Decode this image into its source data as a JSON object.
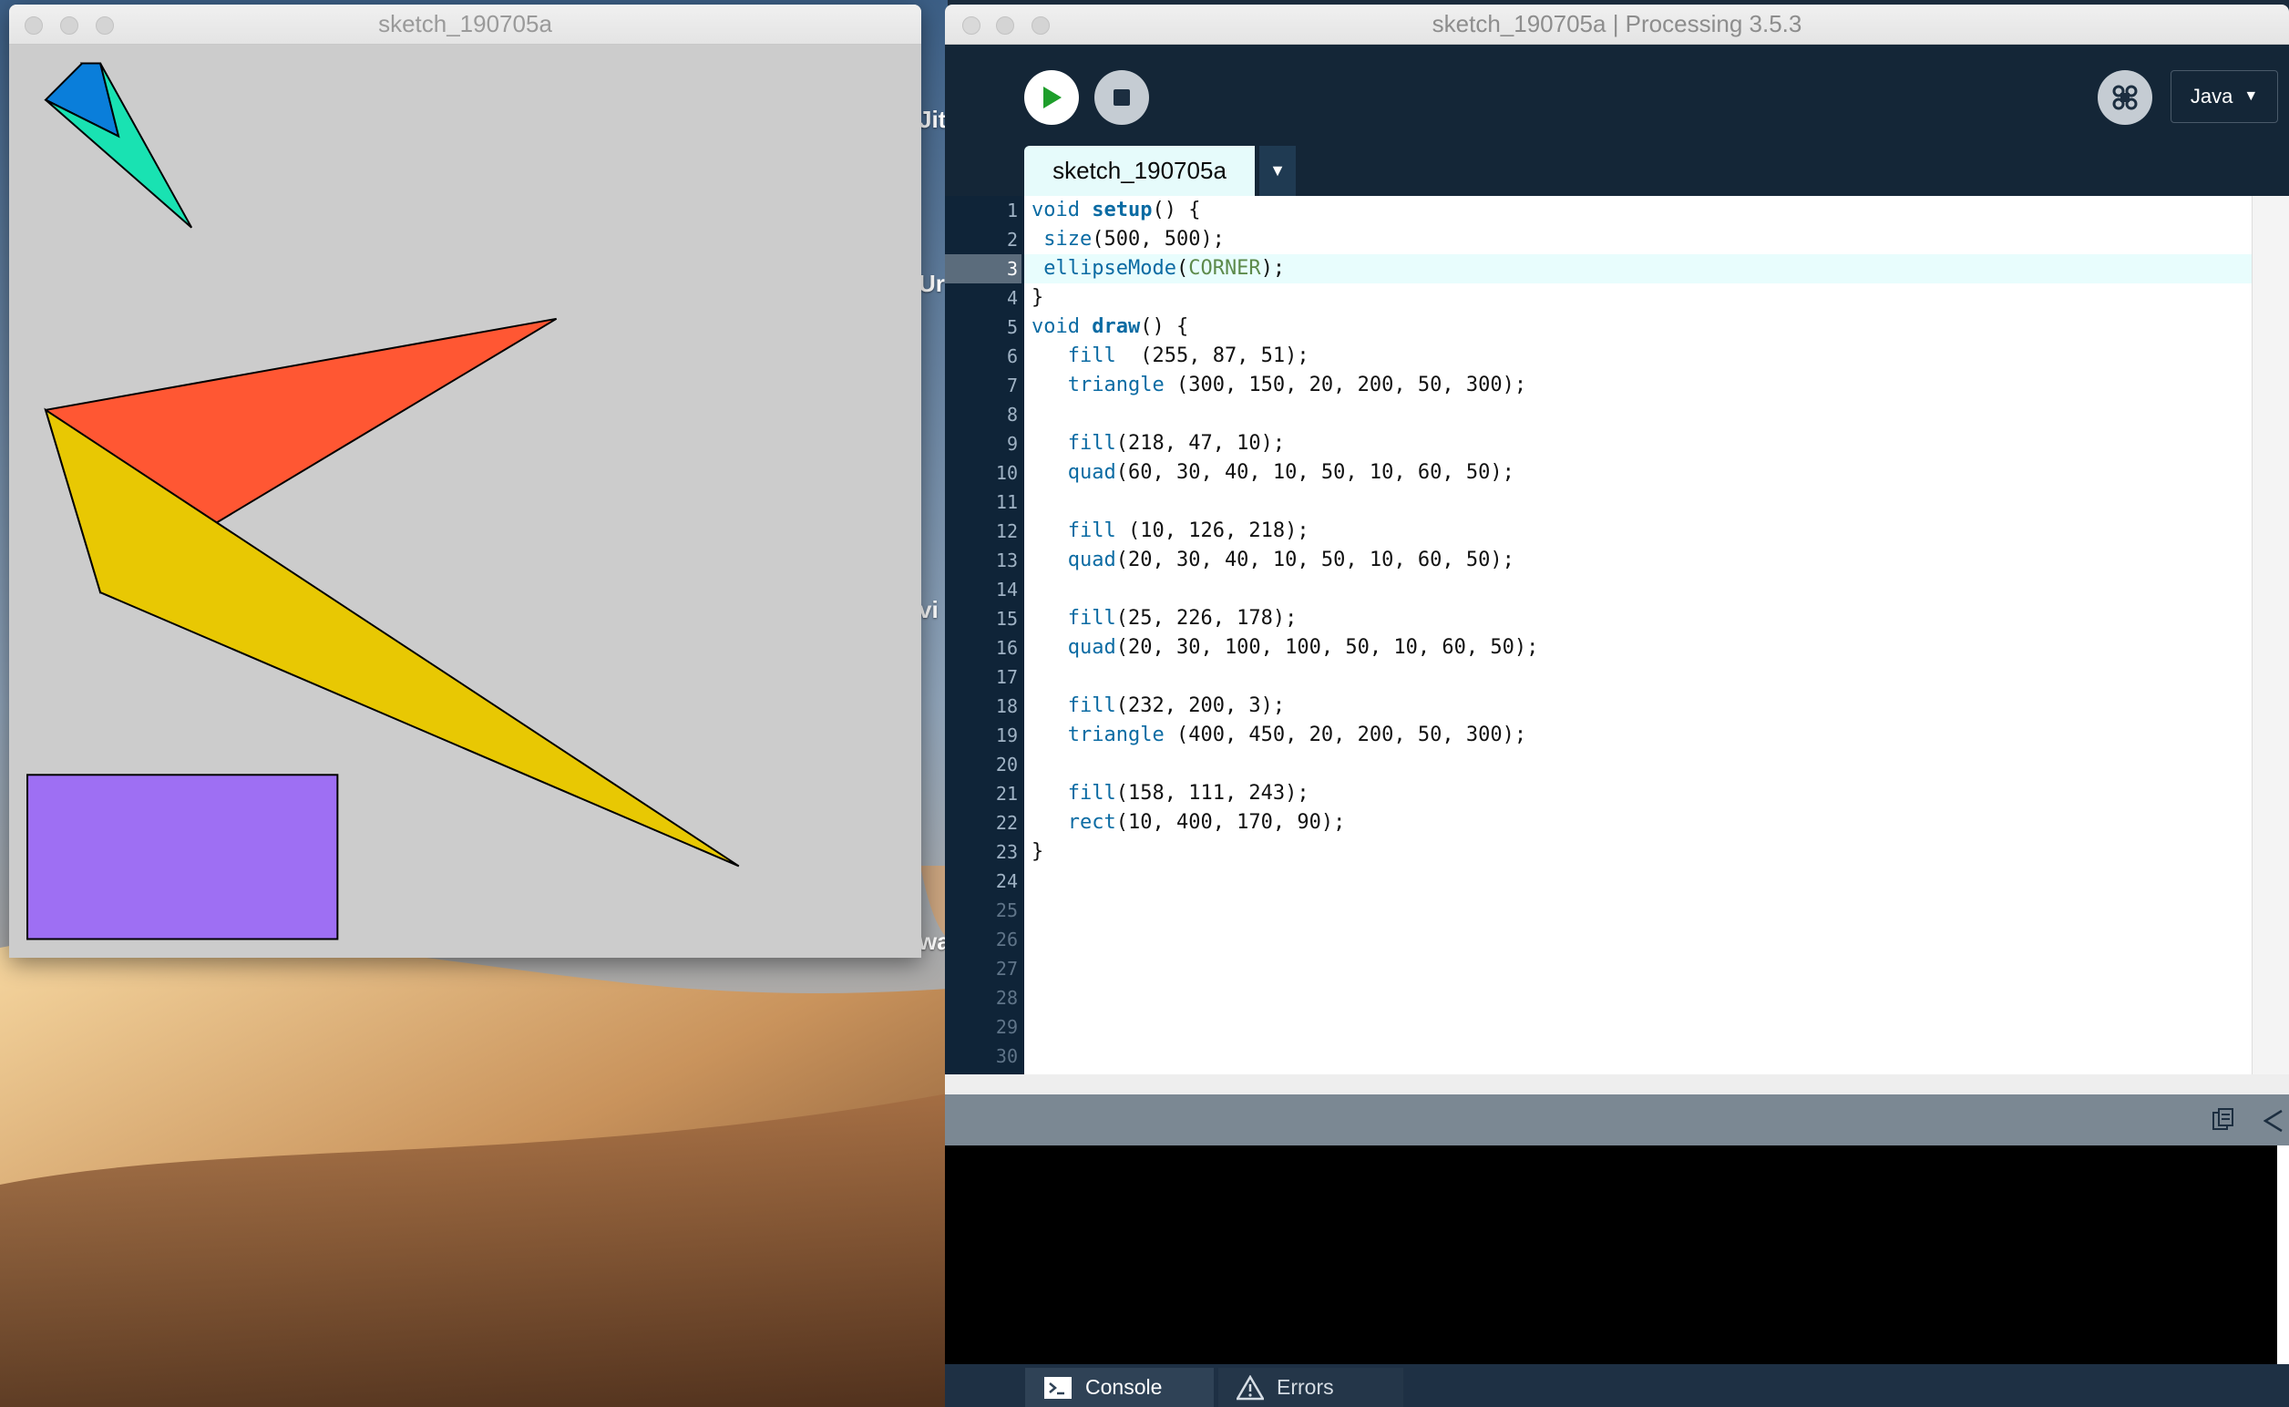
{
  "desktop": {
    "peek_labels": [
      "Jit",
      "Ur",
      "vi",
      "wa"
    ]
  },
  "sketch_window": {
    "title": "sketch_190705a"
  },
  "ide_window": {
    "title": "sketch_190705a | Processing 3.5.3",
    "toolbar": {
      "run_label": "Run",
      "stop_label": "Stop",
      "mode_label": "Java",
      "mode_arrow": "▼"
    },
    "tab": {
      "name": "sketch_190705a",
      "menu_arrow": "▼"
    },
    "current_line": 3,
    "line_count": 30,
    "last_code_line": 23,
    "code_lines": [
      [
        {
          "t": "void ",
          "c": "kw"
        },
        {
          "t": "setup",
          "c": "fn bold"
        },
        {
          "t": "() {",
          "c": "plain"
        }
      ],
      [
        {
          "t": " ",
          "c": "plain"
        },
        {
          "t": "size",
          "c": "fn"
        },
        {
          "t": "(500, 500);",
          "c": "plain"
        }
      ],
      [
        {
          "t": " ",
          "c": "plain"
        },
        {
          "t": "ellipseMode",
          "c": "fn"
        },
        {
          "t": "(",
          "c": "plain"
        },
        {
          "t": "CORNER",
          "c": "const"
        },
        {
          "t": ");",
          "c": "plain"
        }
      ],
      [
        {
          "t": "}",
          "c": "plain"
        }
      ],
      [
        {
          "t": "void ",
          "c": "kw"
        },
        {
          "t": "draw",
          "c": "fn bold"
        },
        {
          "t": "() {",
          "c": "plain"
        }
      ],
      [
        {
          "t": "   ",
          "c": "plain"
        },
        {
          "t": "fill",
          "c": "fn"
        },
        {
          "t": "  (255, 87, 51);",
          "c": "plain"
        }
      ],
      [
        {
          "t": "   ",
          "c": "plain"
        },
        {
          "t": "triangle",
          "c": "fn"
        },
        {
          "t": " (300, 150, 20, 200, 50, 300);",
          "c": "plain"
        }
      ],
      [],
      [
        {
          "t": "   ",
          "c": "plain"
        },
        {
          "t": "fill",
          "c": "fn"
        },
        {
          "t": "(218, 47, 10);",
          "c": "plain"
        }
      ],
      [
        {
          "t": "   ",
          "c": "plain"
        },
        {
          "t": "quad",
          "c": "fn"
        },
        {
          "t": "(60, 30, 40, 10, 50, 10, 60, 50);",
          "c": "plain"
        }
      ],
      [],
      [
        {
          "t": "   ",
          "c": "plain"
        },
        {
          "t": "fill",
          "c": "fn"
        },
        {
          "t": " (10, 126, 218);",
          "c": "plain"
        }
      ],
      [
        {
          "t": "   ",
          "c": "plain"
        },
        {
          "t": "quad",
          "c": "fn"
        },
        {
          "t": "(20, 30, 40, 10, 50, 10, 60, 50);",
          "c": "plain"
        }
      ],
      [],
      [
        {
          "t": "   ",
          "c": "plain"
        },
        {
          "t": "fill",
          "c": "fn"
        },
        {
          "t": "(25, 226, 178);",
          "c": "plain"
        }
      ],
      [
        {
          "t": "   ",
          "c": "plain"
        },
        {
          "t": "quad",
          "c": "fn"
        },
        {
          "t": "(20, 30, 100, 100, 50, 10, 60, 50);",
          "c": "plain"
        }
      ],
      [],
      [
        {
          "t": "   ",
          "c": "plain"
        },
        {
          "t": "fill",
          "c": "fn"
        },
        {
          "t": "(232, 200, 3);",
          "c": "plain"
        }
      ],
      [
        {
          "t": "   ",
          "c": "plain"
        },
        {
          "t": "triangle",
          "c": "fn"
        },
        {
          "t": " (400, 450, 20, 200, 50, 300);",
          "c": "plain"
        }
      ],
      [],
      [
        {
          "t": "   ",
          "c": "plain"
        },
        {
          "t": "fill",
          "c": "fn"
        },
        {
          "t": "(158, 111, 243);",
          "c": "plain"
        }
      ],
      [
        {
          "t": "   ",
          "c": "plain"
        },
        {
          "t": "rect",
          "c": "fn"
        },
        {
          "t": "(10, 400, 170, 90);",
          "c": "plain"
        }
      ],
      [
        {
          "t": "}",
          "c": "plain"
        }
      ]
    ],
    "console_tabs": {
      "console_label": "Console",
      "errors_label": "Errors"
    }
  },
  "colors": {
    "orange": "#ff5733",
    "dark_orange": "#da2f0a",
    "blue": "#0a7eda",
    "teal": "#19e2b2",
    "yellow": "#e8c803",
    "purple": "#9e6ff3",
    "canvas_bg": "#cccccc",
    "ide_dark": "#142637",
    "run_green": "#1e9e2b"
  }
}
